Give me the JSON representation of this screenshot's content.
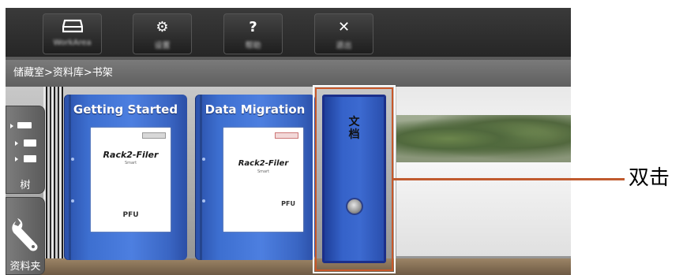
{
  "toolbar": {
    "buttons": [
      {
        "name": "workarea-button",
        "icon": "tray-icon",
        "label": "WorkArea"
      },
      {
        "name": "settings-button",
        "icon": "gear-icon",
        "label": "设置"
      },
      {
        "name": "help-button",
        "icon": "question-icon",
        "label": "帮助"
      },
      {
        "name": "close-button",
        "icon": "close-icon",
        "label": "退出"
      }
    ]
  },
  "breadcrumb": {
    "text": "储藏室>资料库>书架"
  },
  "sidebar": {
    "tree_tab": {
      "label": "树",
      "icon": "folder-tree-icon"
    },
    "folder_tab": {
      "label": "资料夹",
      "icon": "wrench-icon"
    }
  },
  "binders": [
    {
      "title": "Getting Started",
      "logo": "Rack2-Filer",
      "logo_sub": "Smart",
      "brand": "PFU",
      "color": "#3d6fd0"
    },
    {
      "title": "Data Migration",
      "logo": "Rack2-Filer",
      "logo_sub": "Smart",
      "brand": "PFU",
      "color": "#3d6fd0"
    }
  ],
  "document_binder": {
    "title_line1": "文",
    "title_line2": "档",
    "color": "#3562c9"
  },
  "callout": {
    "label": "双击",
    "color": "#c05a2e"
  }
}
